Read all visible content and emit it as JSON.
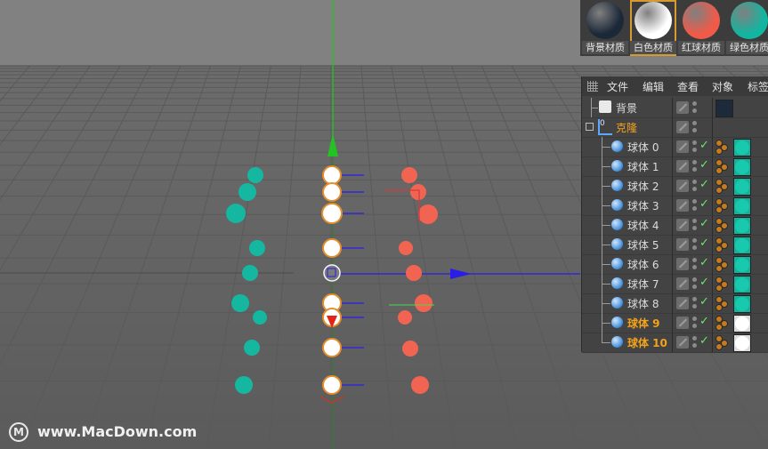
{
  "materials": [
    {
      "label": "背景材质",
      "color": "#1b2838"
    },
    {
      "label": "白色材质",
      "color": "#ffffff"
    },
    {
      "label": "红球材质",
      "color": "#f05a48"
    },
    {
      "label": "绿色材质",
      "color": "#12b59f"
    }
  ],
  "object_manager": {
    "menu": [
      "文件",
      "编辑",
      "查看",
      "对象",
      "标签"
    ],
    "background_label": "背景",
    "cloner_label": "克隆",
    "spheres": [
      {
        "name": "球体 0",
        "material": "green",
        "highlight": false
      },
      {
        "name": "球体 1",
        "material": "green",
        "highlight": false
      },
      {
        "name": "球体 2",
        "material": "green",
        "highlight": false
      },
      {
        "name": "球体 3",
        "material": "green",
        "highlight": false
      },
      {
        "name": "球体 4",
        "material": "green",
        "highlight": false
      },
      {
        "name": "球体 5",
        "material": "green",
        "highlight": false
      },
      {
        "name": "球体 6",
        "material": "green",
        "highlight": false
      },
      {
        "name": "球体 7",
        "material": "green",
        "highlight": false
      },
      {
        "name": "球体 8",
        "material": "green",
        "highlight": false
      },
      {
        "name": "球体 9",
        "material": "white",
        "highlight": true
      },
      {
        "name": "球体 10",
        "material": "white",
        "highlight": true
      }
    ]
  },
  "viewport": {
    "colors": {
      "teal": "#15b7a0",
      "red": "#f26452",
      "white": "#ffffff",
      "y_axis": "#22c322",
      "x_axis": "#2a1ee6"
    }
  },
  "watermark": {
    "text": "www.MacDown.com",
    "logo": "M"
  }
}
